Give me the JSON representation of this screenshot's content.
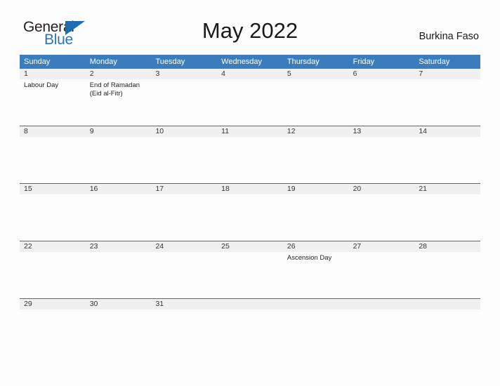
{
  "header": {
    "logo": {
      "word1": "General",
      "word2": "Blue",
      "triangle_color": "#1f6cb0",
      "word2_color": "#2a73b8"
    },
    "title": "May 2022",
    "country": "Burkina Faso"
  },
  "calendar": {
    "header_bg": "#3b7cbd",
    "header_text_color": "#ffffff",
    "daynum_bg": "#f0f0f0",
    "divider_color": "#2f72b0",
    "weekdays": [
      "Sunday",
      "Monday",
      "Tuesday",
      "Wednesday",
      "Thursday",
      "Friday",
      "Saturday"
    ],
    "weeks": [
      {
        "days": [
          {
            "num": "1",
            "events": [
              "Labour Day"
            ]
          },
          {
            "num": "2",
            "events": [
              "End of Ramadan",
              "(Eid al-Fitr)"
            ]
          },
          {
            "num": "3",
            "events": []
          },
          {
            "num": "4",
            "events": []
          },
          {
            "num": "5",
            "events": []
          },
          {
            "num": "6",
            "events": []
          },
          {
            "num": "7",
            "events": []
          }
        ]
      },
      {
        "days": [
          {
            "num": "8",
            "events": []
          },
          {
            "num": "9",
            "events": []
          },
          {
            "num": "10",
            "events": []
          },
          {
            "num": "11",
            "events": []
          },
          {
            "num": "12",
            "events": []
          },
          {
            "num": "13",
            "events": []
          },
          {
            "num": "14",
            "events": []
          }
        ]
      },
      {
        "days": [
          {
            "num": "15",
            "events": []
          },
          {
            "num": "16",
            "events": []
          },
          {
            "num": "17",
            "events": []
          },
          {
            "num": "18",
            "events": []
          },
          {
            "num": "19",
            "events": []
          },
          {
            "num": "20",
            "events": []
          },
          {
            "num": "21",
            "events": []
          }
        ]
      },
      {
        "days": [
          {
            "num": "22",
            "events": []
          },
          {
            "num": "23",
            "events": []
          },
          {
            "num": "24",
            "events": []
          },
          {
            "num": "25",
            "events": []
          },
          {
            "num": "26",
            "events": [
              "Ascension Day"
            ]
          },
          {
            "num": "27",
            "events": []
          },
          {
            "num": "28",
            "events": []
          }
        ]
      },
      {
        "days": [
          {
            "num": "29",
            "events": []
          },
          {
            "num": "30",
            "events": []
          },
          {
            "num": "31",
            "events": []
          },
          {
            "num": "",
            "events": []
          },
          {
            "num": "",
            "events": []
          },
          {
            "num": "",
            "events": []
          },
          {
            "num": "",
            "events": []
          }
        ]
      }
    ]
  }
}
